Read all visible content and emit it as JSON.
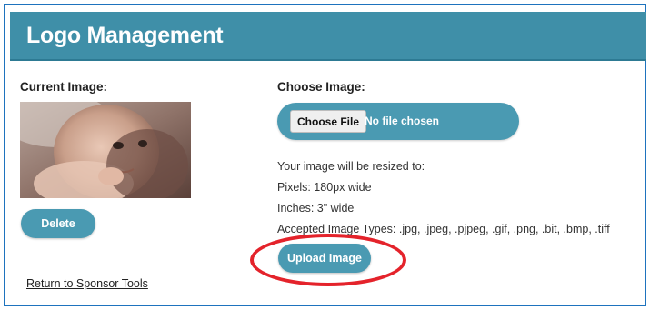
{
  "header": {
    "title": "Logo Management"
  },
  "current": {
    "label": "Current Image:",
    "delete_label": "Delete"
  },
  "choose": {
    "label": "Choose Image:",
    "file_button_label": "Choose File",
    "file_status": "No file chosen"
  },
  "info": {
    "line1": "Your image will be resized to:",
    "line2": "Pixels: 180px wide",
    "line3": "Inches: 3\" wide",
    "line4": "Accepted Image Types: .jpg, .jpeg, .pjpeg, .gif, .png, .bit, .bmp, .tiff"
  },
  "upload_label": "Upload Image",
  "return_link": "Return to Sponsor Tools",
  "colors": {
    "header_bg": "#3f8fa8",
    "button_bg": "#4a9ab2",
    "annotation_circle": "#e4232b",
    "frame_border": "#1e73be"
  }
}
